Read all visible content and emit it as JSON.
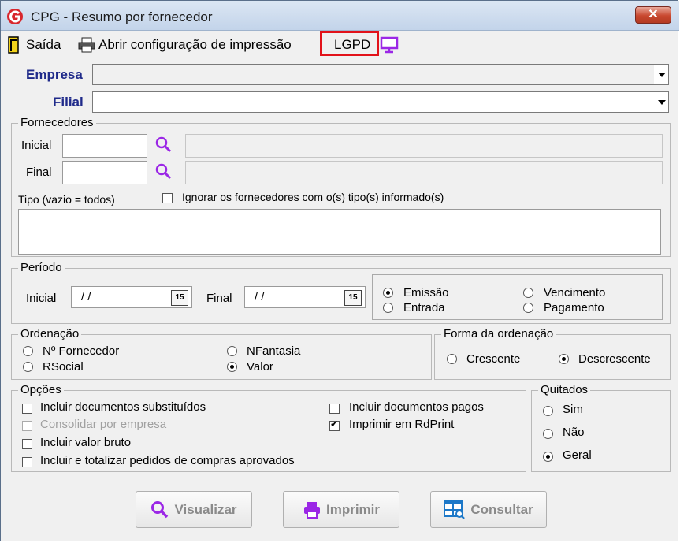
{
  "window": {
    "title": "CPG - Resumo por fornecedor",
    "close": "✕"
  },
  "toolbar": {
    "exit_label": "Saída",
    "print_config_label": "Abrir configuração de impressão",
    "lgpd_label": "LGPD"
  },
  "fields": {
    "empresa_label": "Empresa",
    "empresa_value": "",
    "filial_label": "Filial",
    "filial_value": ""
  },
  "fornecedores": {
    "legend": "Fornecedores",
    "initial_label": "Inicial",
    "initial_value": "",
    "initial_name": "",
    "final_label": "Final",
    "final_value": "",
    "final_name": "",
    "tipo_label": "Tipo (vazio = todos)",
    "ignore_label": "Ignorar os fornecedores com o(s) tipo(s) informado(s)",
    "ignore_checked": false,
    "tipo_value": ""
  },
  "periodo": {
    "legend": "Período",
    "initial_label": "Inicial",
    "initial_value": "/ /",
    "final_label": "Final",
    "final_value": "/ /",
    "calendar_text": "15",
    "options": [
      "Emissão",
      "Entrada",
      "Vencimento",
      "Pagamento"
    ],
    "selected": "Emissão"
  },
  "ordenacao": {
    "legend": "Ordenação",
    "options": [
      "Nº Fornecedor",
      "RSocial",
      "NFantasia",
      "Valor"
    ],
    "selected": "Valor"
  },
  "forma": {
    "legend": "Forma da ordenação",
    "options": [
      "Crescente",
      "Descrescente"
    ],
    "selected": "Descrescente"
  },
  "opcoes": {
    "legend": "Opções",
    "items": [
      {
        "label": "Incluir documentos substituídos",
        "checked": false,
        "enabled": true
      },
      {
        "label": "Consolidar por empresa",
        "checked": false,
        "enabled": false
      },
      {
        "label": "Incluir valor bruto",
        "checked": false,
        "enabled": true
      },
      {
        "label": "Incluir e totalizar pedidos de compras aprovados",
        "checked": false,
        "enabled": true
      },
      {
        "label": "Incluir documentos pagos",
        "checked": false,
        "enabled": true
      },
      {
        "label": "Imprimir em RdPrint",
        "checked": true,
        "enabled": true
      }
    ]
  },
  "quitados": {
    "legend": "Quitados",
    "options": [
      "Sim",
      "Não",
      "Geral"
    ],
    "selected": "Geral"
  },
  "buttons": {
    "visualizar": "Visualizar",
    "imprimir": "Imprimir",
    "consultar": "Consultar"
  },
  "colors": {
    "label_blue": "#1f2a8a",
    "lgpd_highlight": "#e2121a",
    "accent_purple": "#9b27e6"
  }
}
